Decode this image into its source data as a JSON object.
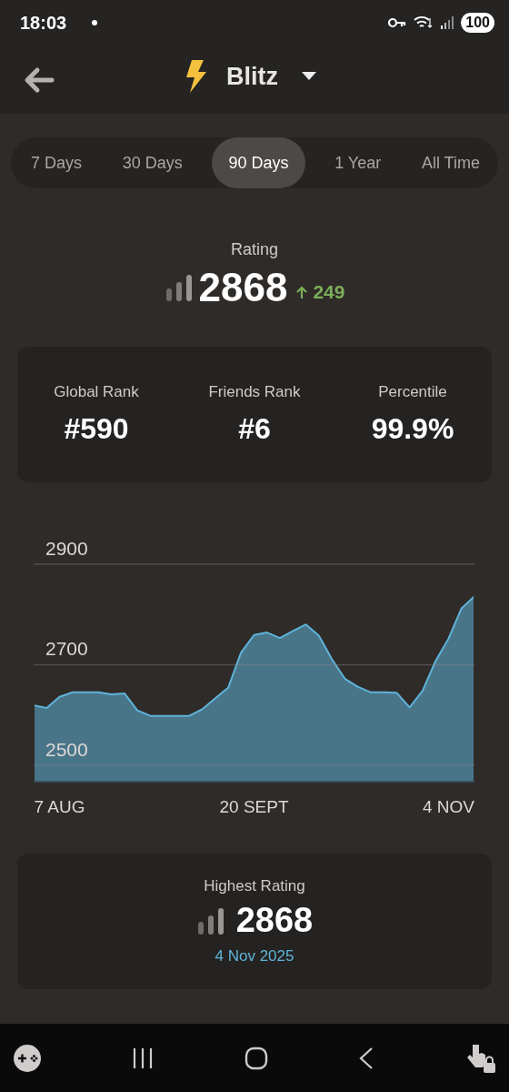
{
  "status_bar": {
    "time": "18:03",
    "battery": "100"
  },
  "header": {
    "title": "Blitz"
  },
  "period_tabs": [
    {
      "label": "7 Days",
      "selected": false
    },
    {
      "label": "30 Days",
      "selected": false
    },
    {
      "label": "90 Days",
      "selected": true
    },
    {
      "label": "1 Year",
      "selected": false
    },
    {
      "label": "All Time",
      "selected": false
    }
  ],
  "rating": {
    "label": "Rating",
    "value": "2868",
    "change": "249"
  },
  "stats": [
    {
      "label": "Global Rank",
      "value": "#590"
    },
    {
      "label": "Friends Rank",
      "value": "#6"
    },
    {
      "label": "Percentile",
      "value": "99.9%"
    }
  ],
  "chart": {
    "chart_data": {
      "type": "area",
      "categories": [
        null,
        null,
        "7 AUG",
        null,
        null,
        null,
        null,
        null,
        null,
        null,
        null,
        null,
        null,
        null,
        null,
        null,
        null,
        "20 SEPT",
        null,
        null,
        null,
        null,
        null,
        null,
        null,
        null,
        null,
        null,
        null,
        null,
        null,
        null,
        "4 NOV",
        null,
        null
      ],
      "series": [
        {
          "color": "#5fb3d9",
          "values": [
            2619,
            2614,
            2636,
            2645,
            2645,
            2645,
            2641,
            2643,
            2609,
            2598,
            2598,
            2598,
            2598,
            2611,
            2633,
            2654,
            2724,
            2759,
            2764,
            2753,
            2767,
            2780,
            2758,
            2711,
            2672,
            2656,
            2645,
            2645,
            2644,
            2615,
            2648,
            2707,
            2752,
            2812,
            2836
          ]
        }
      ],
      "ylim": [
        2467,
        2900
      ],
      "yticks": [
        2500,
        2700,
        2900
      ]
    }
  },
  "highest": {
    "label": "Highest Rating",
    "value": "2868",
    "date": "4 Nov 2025"
  }
}
